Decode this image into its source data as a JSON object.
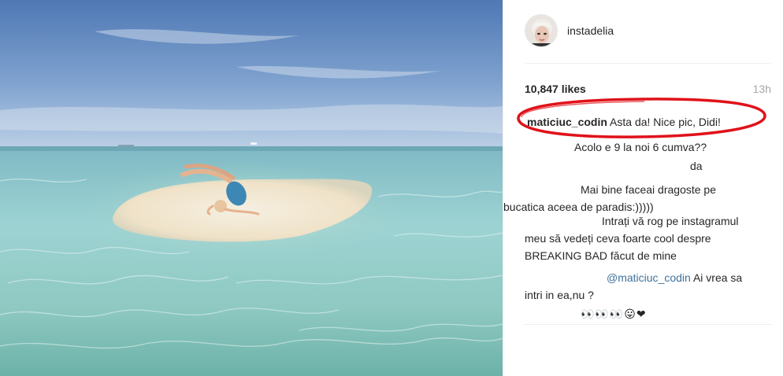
{
  "post": {
    "username": "instadelia",
    "likes": "10,847 likes",
    "time": "13h"
  },
  "comments": [
    {
      "author": "maticiuc_codin",
      "text": "Asta da! Nice pic, Didi!"
    },
    {
      "text": "Acolo e 9 la noi 6 cumva??"
    },
    {
      "text": "da"
    },
    {
      "line1": "Mai bine faceai dragoste pe",
      "line2": "bucatica aceea de paradis:)))))"
    },
    {
      "line1": "Intrați vă rog pe instagramul",
      "line2": "meu să vedeți ceva foarte cool despre",
      "line3": "BREAKING BAD făcut de mine"
    },
    {
      "mention": "@maticiuc_codin",
      "line1": "Ai vrea sa",
      "line2": "intri in ea,nu ?"
    },
    {
      "text": "👀👀👀😛❤"
    }
  ],
  "icons": {
    "avatar": "profile-avatar",
    "photo": "beach-sandbar-photo",
    "annotation": "red-ellipse-highlight"
  },
  "colors": {
    "annotation_red": "#e0121a",
    "mention_blue": "#3f729b",
    "muted_gray": "#a5a7aa"
  }
}
